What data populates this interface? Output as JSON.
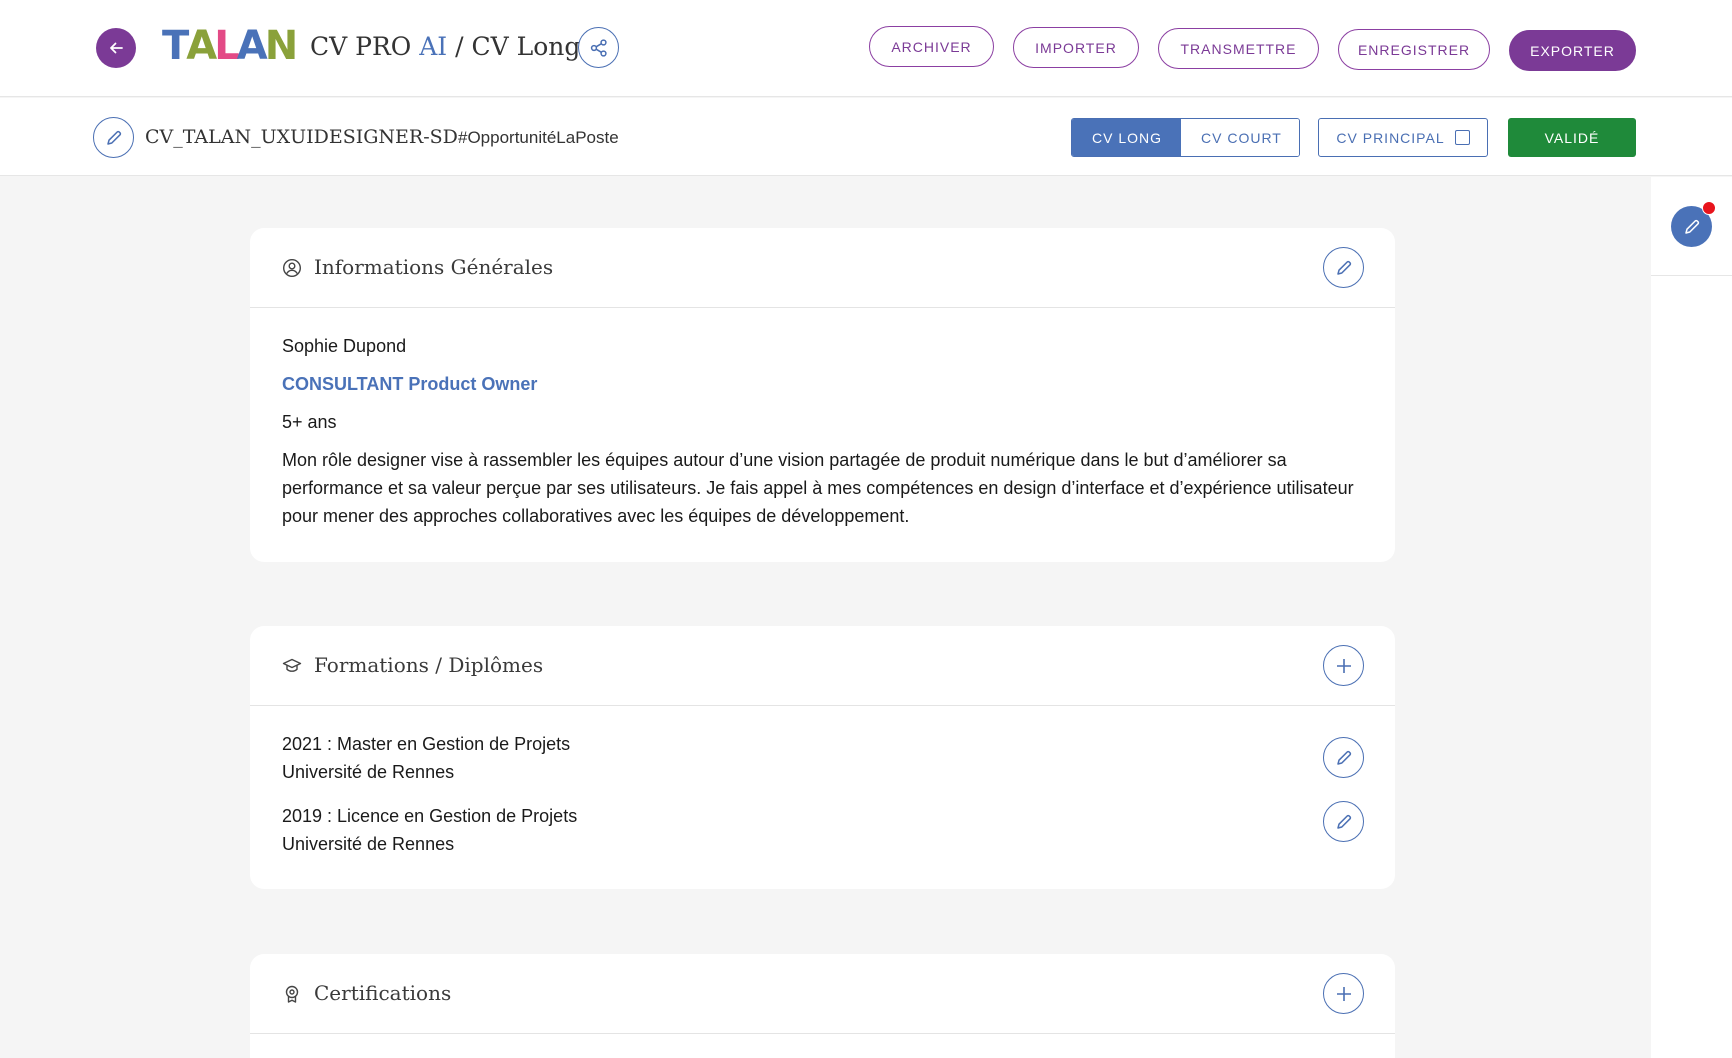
{
  "header": {
    "logo": {
      "letters": [
        {
          "ch": "T",
          "color": "#4a72b8"
        },
        {
          "ch": "A",
          "color": "#8aa13a"
        },
        {
          "ch": "L",
          "color": "#e34a86"
        },
        {
          "ch": "A",
          "color": "#4a72b8"
        },
        {
          "ch": "N",
          "color": "#8aa13a"
        }
      ]
    },
    "title_prefix": "CV PRO ",
    "title_ai": "AI",
    "title_suffix": " / CV Long",
    "buttons": {
      "archiver": "ARCHIVER",
      "importer": "IMPORTER",
      "transmettre": "TRANSMETTRE",
      "enregistrer": "ENREGISTRER",
      "exporter": "EXPORTER"
    }
  },
  "subbar": {
    "file_name": "CV_TALAN_UXUIDESIGNER-SD",
    "hashtag": "#OpportunitéLaPoste",
    "toggle": {
      "long": "CV LONG",
      "court": "CV COURT",
      "selected": "CV LONG"
    },
    "principal": "CV PRINCIPAL",
    "principal_checked": false,
    "valide": "VALIDÉ"
  },
  "sections": {
    "infos": {
      "title": "Informations Générales",
      "name": "Sophie Dupond",
      "role": "CONSULTANT Product Owner",
      "experience": "5+ ans",
      "bio": "Mon rôle designer vise à rassembler les équipes autour d’une vision partagée de produit numérique dans le but d’améliorer sa performance et sa valeur perçue par ses utilisateurs. Je fais appel à mes compétences en design d’interface et d’expérience utilisateur pour mener des approches collaboratives avec les équipes de développement."
    },
    "formations": {
      "title": "Formations / Diplômes",
      "items": [
        {
          "line1": "2021 : Master en Gestion de Projets",
          "line2": "Université de Rennes"
        },
        {
          "line1": "2019 : Licence en Gestion de Projets",
          "line2": "Université de Rennes"
        }
      ]
    },
    "certifications": {
      "title": "Certifications"
    }
  },
  "colors": {
    "brand_purple": "#7b3a96",
    "accent_blue": "#4a72b8",
    "success_green": "#1f8a3a",
    "notification_red": "#e8141c"
  },
  "icons": {
    "back": "arrow-left-icon",
    "share": "share-icon",
    "edit": "pencil-icon",
    "add": "plus-icon",
    "user": "user-circle-icon",
    "education": "graduation-cap-icon",
    "certificate": "award-icon"
  }
}
